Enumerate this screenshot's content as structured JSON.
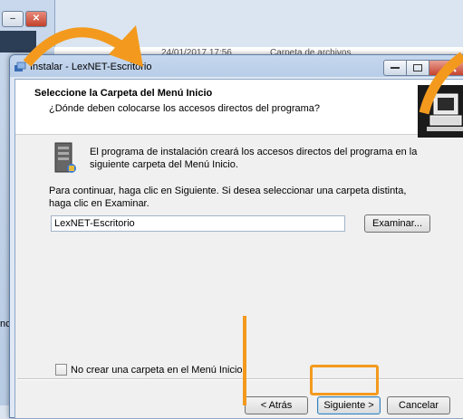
{
  "background": {
    "close_glyph": "✕",
    "min_glyph": "–",
    "row_text": "nc",
    "header_date": "24/01/2017 17:56",
    "header_type": "Carpeta de archivos"
  },
  "dialog": {
    "title": "Instalar - LexNET-Escritorio",
    "header": {
      "title": "Seleccione la Carpeta del Menú Inicio",
      "subtitle": "¿Dónde deben colocarse los accesos directos del programa?"
    },
    "info_text": "El programa de instalación creará los accesos directos del programa en la siguiente carpeta del Menú Inicio.",
    "instruction_text": "Para continuar, haga clic en Siguiente. Si desea seleccionar una carpeta distinta, haga clic en Examinar.",
    "folder_value": "LexNET-Escritorio",
    "browse_label": "Examinar...",
    "checkbox_label": "No crear una carpeta en el Menú Inicio",
    "checkbox_checked": false,
    "back_label": "< Atrás",
    "next_label": "Siguiente >",
    "cancel_label": "Cancelar"
  },
  "annotation_color": "#f39a1e"
}
